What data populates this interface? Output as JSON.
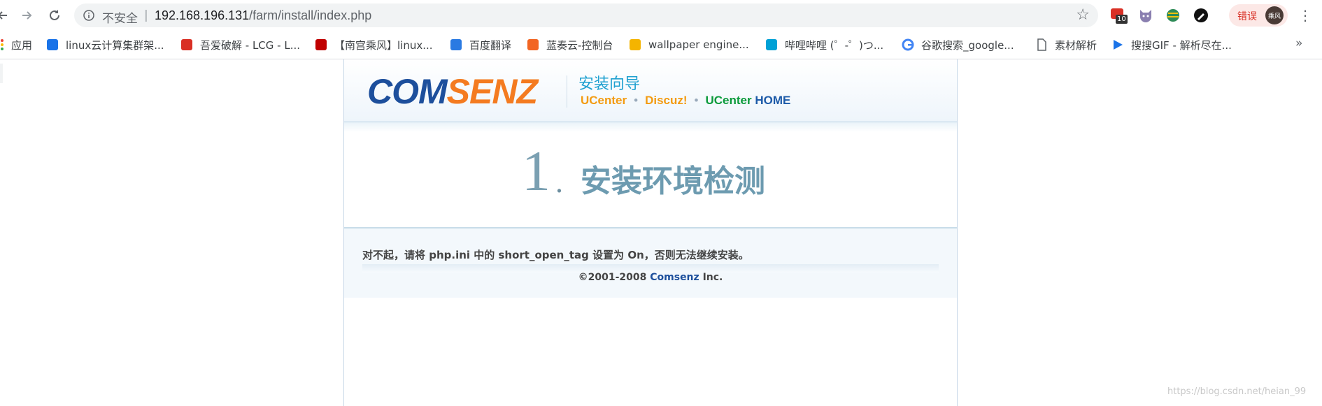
{
  "browser": {
    "security_label": "不安全",
    "separator": "|",
    "url_host": "192.168.196.131",
    "url_path": "/farm/install/index.php",
    "extension_badge": "10",
    "profile_status": "错误",
    "profile_avatar_text": "乘风"
  },
  "bookmarks": [
    {
      "label": "应用",
      "icon": "apps-icon",
      "color": "#ea4335"
    },
    {
      "label": "linux云计算集群架...",
      "icon": "cloud-icon",
      "color": "#1a73e8"
    },
    {
      "label": "吾爱破解 - LCG - L...",
      "icon": "lcg-icon",
      "color": "#d93025"
    },
    {
      "label": "【南宫乘风】linux...",
      "icon": "csdn-icon",
      "color": "#c00000"
    },
    {
      "label": "百度翻译",
      "icon": "translate-icon",
      "color": "#2a7ae2"
    },
    {
      "label": "蓝奏云-控制台",
      "icon": "lanzou-icon",
      "color": "#f26522"
    },
    {
      "label": "wallpaper engine...",
      "icon": "wallpaper-icon",
      "color": "#f4b400"
    },
    {
      "label": "哔哩哔哩 (゜-゜)つ...",
      "icon": "bilibili-icon",
      "color": "#00a1d6"
    },
    {
      "label": "谷歌搜索_google...",
      "icon": "google-icon",
      "color": "#4285f4"
    },
    {
      "label": "素材解析",
      "icon": "page-icon",
      "color": "#5f6368"
    },
    {
      "label": "搜搜GIF - 解析尽在...",
      "icon": "play-icon",
      "color": "#1a73e8"
    }
  ],
  "bookmarks_more": "»",
  "installer": {
    "logo_com": "COM",
    "logo_senz": "SENZ",
    "wizard_title": "安装向导",
    "product_ucenter": "UCenter",
    "product_discuz": "Discuz!",
    "product_ucenter_home_1": "UCenter",
    "product_ucenter_home_2": "HOME",
    "product_dot": "•",
    "step_number": "1",
    "step_dot": ".",
    "step_title": "安装环境检测",
    "message": "对不起，请将 php.ini 中的 short_open_tag 设置为 On，否则无法继续安装。",
    "copyright_prefix": "©2001-2008",
    "copyright_brand": "Comsenz",
    "copyright_suffix": "Inc."
  },
  "watermark": "https://blog.csdn.net/heian_99"
}
